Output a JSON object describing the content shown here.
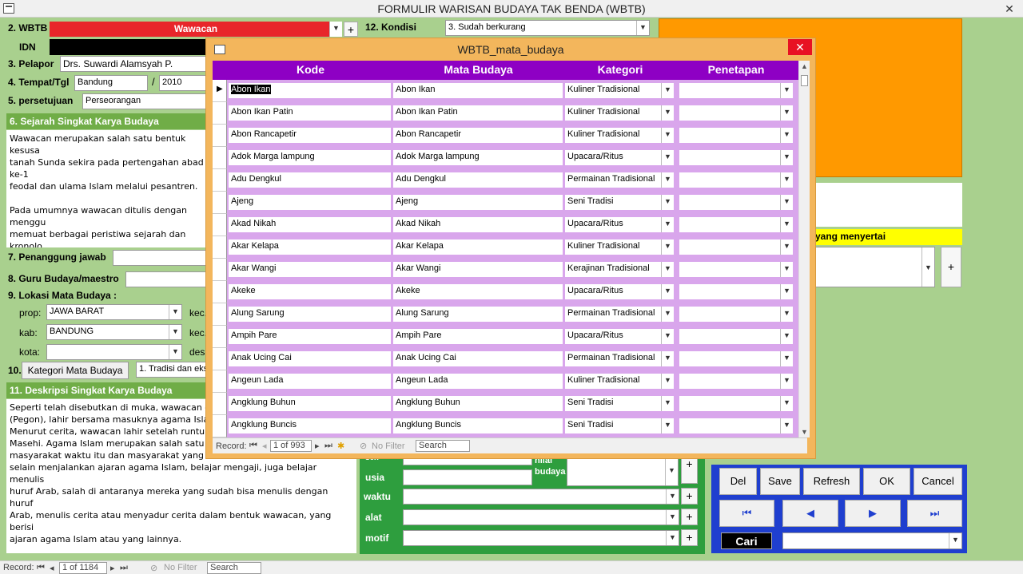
{
  "window": {
    "title": "FORMULIR WARISAN BUDAYA TAK BENDA (WBTB)",
    "close": "✕"
  },
  "form": {
    "wbtb_label": "2. WBTB",
    "wbtb_value": "Wawacan",
    "idn_label": "IDN",
    "pelapor_label": "3. Pelapor",
    "pelapor_value": "Drs. Suwardi Alamsyah P.",
    "tempat_label": "4. Tempat/Tgl",
    "tempat_value": "Bandung",
    "tgl_sep": "/",
    "tgl_value": "2010",
    "persetujuan_label": "5. persetujuan",
    "persetujuan_value": "Perseorangan",
    "kondisi_label": "12. Kondisi",
    "kondisi_value": "3. Sudah berkurang",
    "sejarah_header": "6. Sejarah Singkat Karya Budaya",
    "sejarah_text": "Wawacan merupakan salah satu bentuk kesusa\ntanah Sunda sekira pada pertengahan abad ke-1\nfeodal dan ulama Islam melalui pesantren.\n\nPada umumnya wawacan ditulis dengan menggu\nmemuat berbagai peristiwa sejarah dan kronolo\n\nMenurut tradisi Sunda, wawacan sering digunak\nyakni semacam pertunjukkan pembacaan cerita\nhari, terutama ketika habis panen, nadzaran ata",
    "penanggung_label": "7. Penanggung jawab",
    "guru_label": "8. Guru Budaya/maestro",
    "lokasi_label": "9. Lokasi Mata Budaya :",
    "prop_label": "prop:",
    "prop_value": "JAWA BARAT",
    "kec_label": "kec.",
    "kab_label": "kab:",
    "kab_value": "BANDUNG",
    "kec2_label": "kec.",
    "kota_label": "kota:",
    "desa_label": "des",
    "kategori_num": "10.",
    "kategori_button": "Kategori Mata Budaya",
    "kategori_value": "1. Tradisi dan eksp",
    "deskripsi_header": "11. Deskripsi Singkat Karya Budaya",
    "deskripsi_text": "Seperti telah disebutkan di muka, wawacan ditu\n(Pegon), lahir bersama masuknya agama Islam.\nMenurut cerita, wawacan lahir setelah runtuhny\nMasehi. Agama Islam merupakan salah satu peg\nmasyarakat waktu itu dan masyarakat yang mer\nselain menjalankan ajaran agama Islam, belajar mengaji, juga belajar menulis\nhuruf Arab, salah di antaranya mereka yang sudah bisa menulis dengan huruf\nArab, menulis cerita atau menyadur cerita dalam bentuk wawacan, yang berisi\najaran agama Islam atau yang lainnya.",
    "menyertai_label": "yang menyertai",
    "sex_label": "sex",
    "usia_label": "usia",
    "waktu_label": "waktu",
    "alat_label": "alat",
    "motif_label": "motif",
    "nilai_label": "nilai budaya",
    "plus": "+"
  },
  "buttons": {
    "del": "Del",
    "save": "Save",
    "refresh": "Refresh",
    "ok": "OK",
    "cancel": "Cancel",
    "cari": "Cari"
  },
  "nav_icons": [
    "first-record-icon",
    "prev-record-icon",
    "next-record-icon",
    "last-record-icon"
  ],
  "status": {
    "record_label": "Record:",
    "record_pos": "1 of 1184",
    "filter": "No Filter",
    "search": "Search"
  },
  "popup": {
    "title": "WBTB_mata_budaya",
    "close": "✕",
    "columns": {
      "kode": "Kode",
      "mata": "Mata Budaya",
      "kategori": "Kategori",
      "penetapan": "Penetapan"
    },
    "rows": [
      {
        "kode": "Abon Ikan",
        "mata": "Abon Ikan",
        "kategori": "Kuliner Tradisional"
      },
      {
        "kode": "Abon Ikan Patin",
        "mata": "Abon Ikan Patin",
        "kategori": "Kuliner Tradisional"
      },
      {
        "kode": "Abon Rancapetir",
        "mata": "Abon Rancapetir",
        "kategori": "Kuliner Tradisional"
      },
      {
        "kode": "Adok Marga lampung",
        "mata": "Adok Marga lampung",
        "kategori": "Upacara/Ritus"
      },
      {
        "kode": "Adu Dengkul",
        "mata": "Adu Dengkul",
        "kategori": "Permainan Tradisional"
      },
      {
        "kode": "Ajeng",
        "mata": "Ajeng",
        "kategori": "Seni Tradisi"
      },
      {
        "kode": "Akad Nikah",
        "mata": "Akad Nikah",
        "kategori": "Upacara/Ritus"
      },
      {
        "kode": "Akar Kelapa",
        "mata": "Akar Kelapa",
        "kategori": "Kuliner Tradisional"
      },
      {
        "kode": "Akar Wangi",
        "mata": "Akar Wangi",
        "kategori": "Kerajinan Tradisional"
      },
      {
        "kode": "Akeke",
        "mata": "Akeke",
        "kategori": "Upacara/Ritus"
      },
      {
        "kode": "Alung Sarung",
        "mata": "Alung Sarung",
        "kategori": "Permainan Tradisional"
      },
      {
        "kode": "Ampih Pare",
        "mata": "Ampih Pare",
        "kategori": "Upacara/Ritus"
      },
      {
        "kode": "Anak Ucing Cai",
        "mata": "Anak Ucing Cai",
        "kategori": "Permainan Tradisional"
      },
      {
        "kode": "Angeun Lada",
        "mata": "Angeun Lada",
        "kategori": "Kuliner Tradisional"
      },
      {
        "kode": "Angklung Buhun",
        "mata": "Angklung Buhun",
        "kategori": "Seni Tradisi"
      },
      {
        "kode": "Angklung Buncis",
        "mata": "Angklung Buncis",
        "kategori": "Seni Tradisi"
      }
    ],
    "record_label": "Record:",
    "record_pos": "1 of 993",
    "filter": "No Filter",
    "search": "Search"
  },
  "colors": {
    "header_purple": "#8e00c4",
    "row_lavender": "#d9a6ec",
    "form_green": "#a9d08e",
    "section_green": "#70ad47",
    "nav_blue": "#1f3fcf",
    "orange_panel": "#ff9900",
    "wbtb_red": "#e8262a"
  }
}
